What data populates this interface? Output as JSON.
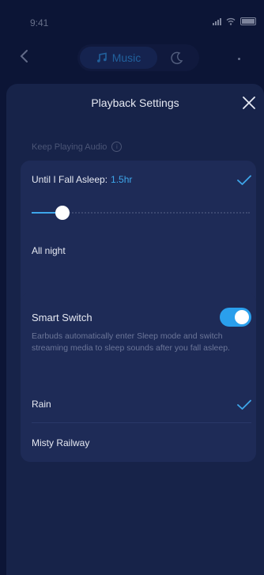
{
  "status_bar": {
    "time": "9:41"
  },
  "top_nav": {
    "mode_music_label": "Music"
  },
  "sheet": {
    "title": "Playback Settings",
    "section_label": "Keep Playing Audio",
    "sleep_option": {
      "label": "Until I Fall Asleep:",
      "duration": "1.5hr",
      "selected": true
    },
    "slider": {
      "value_fraction": 0.14
    },
    "all_night_label": "All night",
    "smart_switch": {
      "title": "Smart Switch",
      "enabled": true,
      "description": "Earbuds automatically enter Sleep mode and switch streaming media to sleep sounds after you fall asleep."
    },
    "sounds": [
      {
        "label": "Rain",
        "selected": true
      },
      {
        "label": "Misty Railway",
        "selected": false
      }
    ]
  },
  "colors": {
    "accent": "#3ea6ea",
    "background": "#0c1536",
    "sheet": "#172349",
    "card": "#1e2b57"
  }
}
